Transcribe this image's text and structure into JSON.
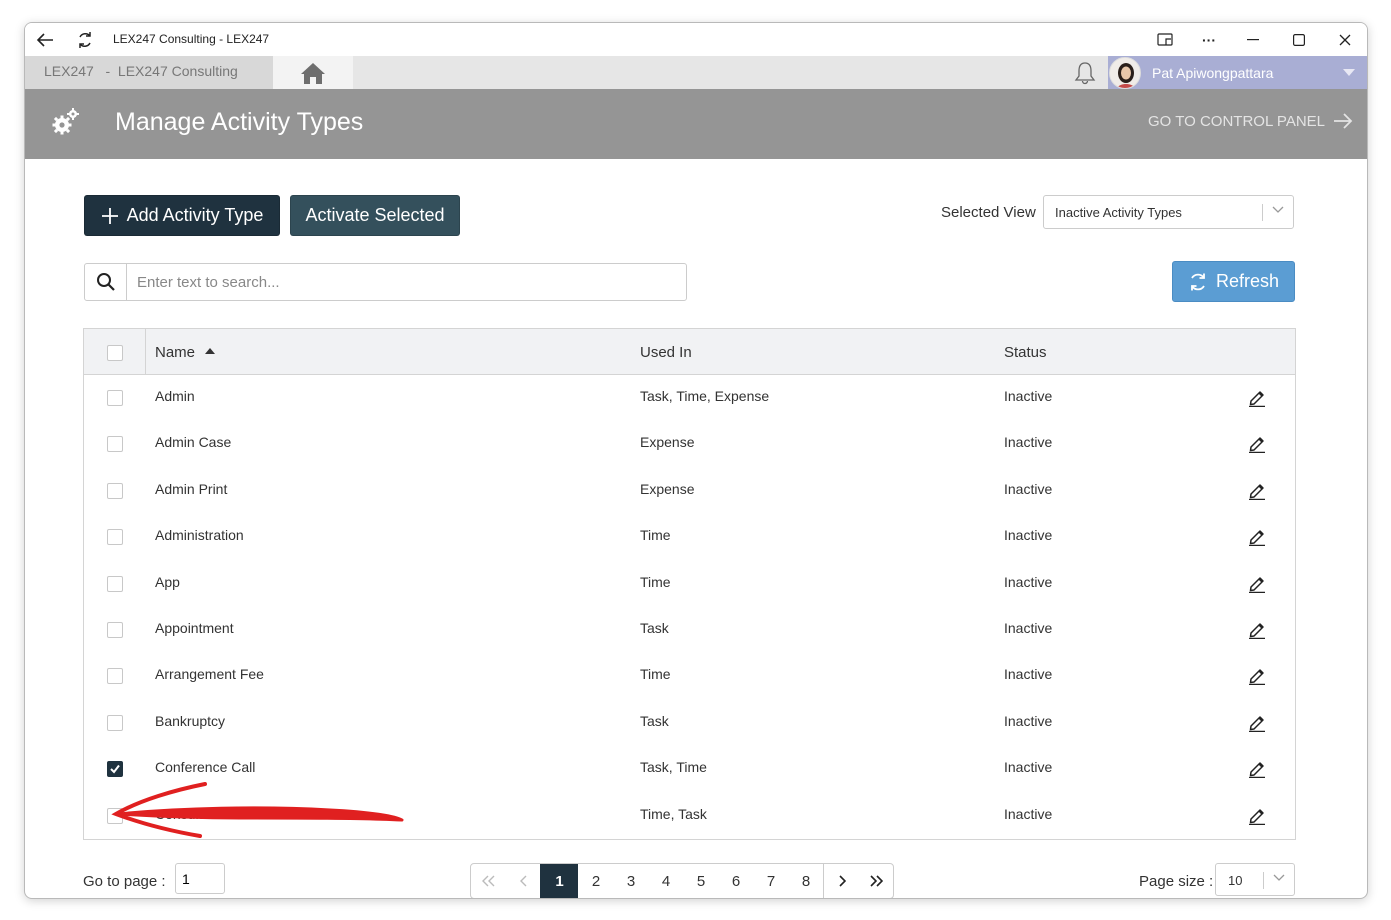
{
  "window": {
    "title": "LEX247 Consulting - LEX247"
  },
  "tabstrip": {
    "tab_label": "LEX247   -  LEX247 Consulting",
    "user_name": "Pat Apiwongpattara"
  },
  "header": {
    "title": "Manage Activity Types",
    "control_panel_link": "GO TO CONTROL PANEL"
  },
  "toolbar": {
    "add_label": "Add Activity Type",
    "activate_label": "Activate Selected",
    "selected_view_label": "Selected View",
    "selected_view_value": "Inactive Activity Types",
    "refresh_label": "Refresh"
  },
  "search": {
    "placeholder": "Enter text to search..."
  },
  "grid": {
    "columns": [
      "Name",
      "Used In",
      "Status"
    ],
    "rows": [
      {
        "name": "Admin",
        "used_in": "Task, Time, Expense",
        "status": "Inactive",
        "checked": false
      },
      {
        "name": "Admin Case",
        "used_in": "Expense",
        "status": "Inactive",
        "checked": false
      },
      {
        "name": "Admin Print",
        "used_in": "Expense",
        "status": "Inactive",
        "checked": false
      },
      {
        "name": "Administration",
        "used_in": "Time",
        "status": "Inactive",
        "checked": false
      },
      {
        "name": "App",
        "used_in": "Time",
        "status": "Inactive",
        "checked": false
      },
      {
        "name": "Appointment",
        "used_in": "Task",
        "status": "Inactive",
        "checked": false
      },
      {
        "name": "Arrangement Fee",
        "used_in": "Time",
        "status": "Inactive",
        "checked": false
      },
      {
        "name": "Bankruptcy",
        "used_in": "Task",
        "status": "Inactive",
        "checked": false
      },
      {
        "name": "Conference Call",
        "used_in": "Task, Time",
        "status": "Inactive",
        "checked": true
      },
      {
        "name": "Consultati",
        "used_in": "Time, Task",
        "status": "Inactive",
        "checked": false
      }
    ]
  },
  "pager": {
    "goto_label": "Go to page :",
    "goto_value": "1",
    "pages": [
      "1",
      "2",
      "3",
      "4",
      "5",
      "6",
      "7",
      "8"
    ],
    "current_page": "1",
    "page_size_label": "Page size :",
    "page_size_value": "10"
  },
  "colors": {
    "header_bg": "#959595",
    "dark_button": "#1f323f",
    "refresh_button": "#5b9dd3",
    "user_box": "#a9aed4",
    "annotation_arrow": "#e02020"
  }
}
